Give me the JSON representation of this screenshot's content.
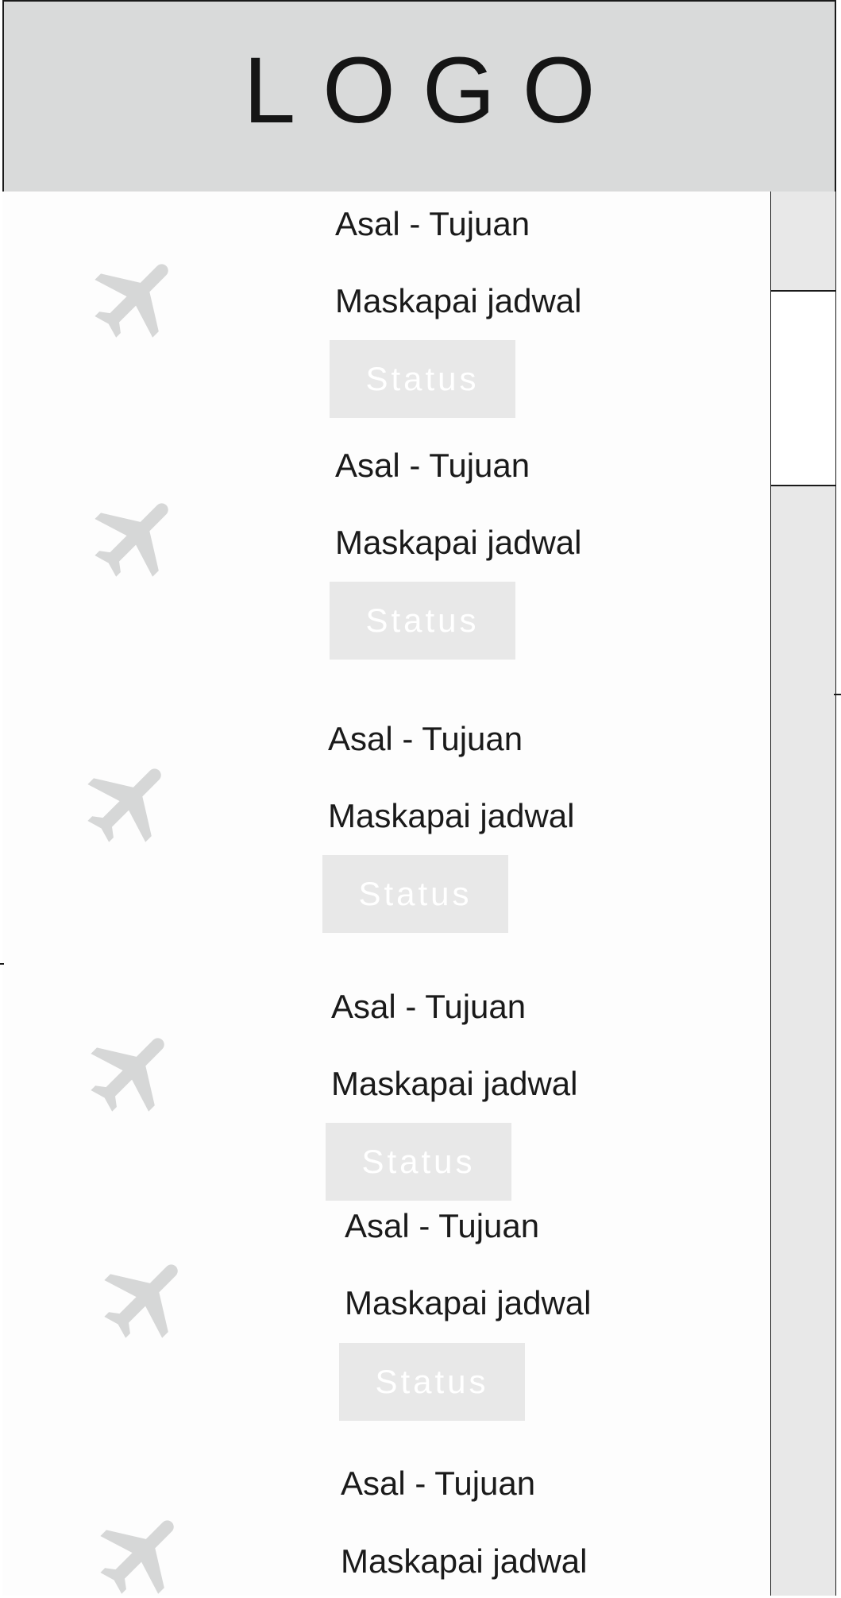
{
  "header": {
    "logo": "LOGO"
  },
  "flights": [
    {
      "route": "Asal - Tujuan",
      "schedule": "Maskapai jadwal",
      "status": "Status",
      "icon": "airplane-icon"
    },
    {
      "route": "Asal - Tujuan",
      "schedule": "Maskapai jadwal",
      "status": "Status",
      "icon": "airplane-icon"
    },
    {
      "route": "Asal - Tujuan",
      "schedule": "Maskapai jadwal",
      "status": "Status",
      "icon": "airplane-icon"
    },
    {
      "route": "Asal - Tujuan",
      "schedule": "Maskapai jadwal",
      "status": "Status",
      "icon": "airplane-icon"
    },
    {
      "route": "Asal - Tujuan",
      "schedule": "Maskapai jadwal",
      "status": "Status",
      "icon": "airplane-icon"
    },
    {
      "route": "Asal - Tujuan",
      "schedule": "Maskapai jadwal",
      "icon": "airplane-icon"
    }
  ],
  "colors": {
    "header_bg": "#d9dada",
    "status_bg": "#e8e8e8",
    "icon": "#d6d7d7",
    "border": "#1a1a1a"
  }
}
